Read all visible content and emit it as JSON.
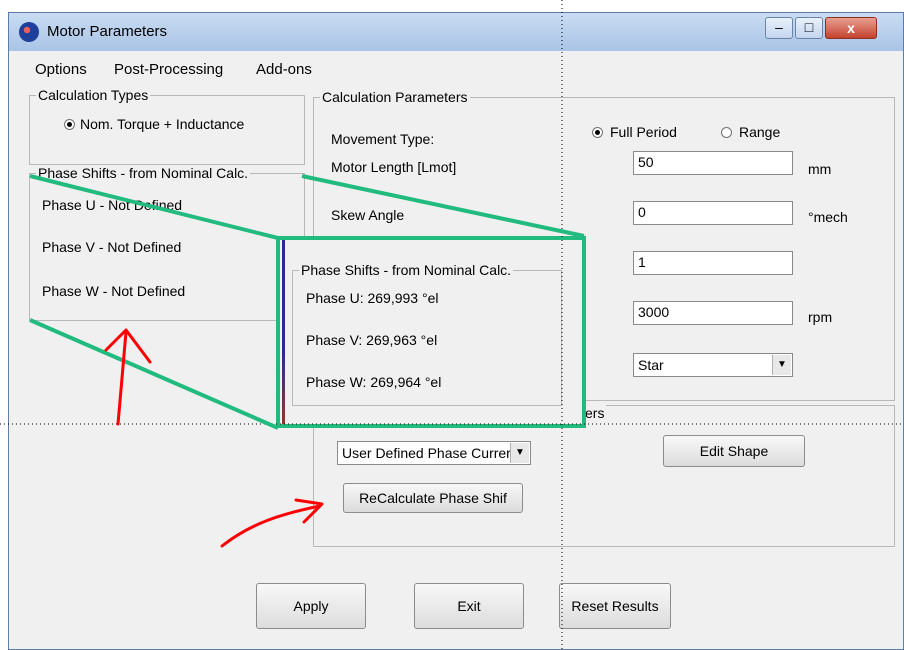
{
  "window": {
    "title": "Motor Parameters",
    "controls": [
      "–",
      "□",
      "x"
    ]
  },
  "menu": [
    "Options",
    "Post-Processing",
    "Add-ons"
  ],
  "calc_types": {
    "legend": "Calculation Types",
    "option_label": "Nom. Torque + Inductance"
  },
  "phase_shifts": {
    "legend": "Phase Shifts - from Nominal Calc.",
    "items": [
      "Phase U - Not Defined",
      "Phase V - Not Defined",
      "Phase W - Not Defined"
    ]
  },
  "calc_params": {
    "legend": "Calculation Parameters",
    "movement_label": "Movement Type:",
    "full_period": "Full Period",
    "range": "Range",
    "motor_length_label": "Motor Length [Lmot]",
    "motor_length_value": "50",
    "motor_length_unit": "mm",
    "skew_label": "Skew Angle",
    "skew_value": "0",
    "skew_unit": "°mech",
    "field3_value": "1",
    "speed_value": "3000",
    "speed_unit": "rpm",
    "connection_value": "Star"
  },
  "magnified": {
    "legend": "Phase Shifts - from Nominal Calc.",
    "items": [
      "Phase U: 269,993 °el",
      "Phase V: 269,963 °el",
      "Phase W: 269,964 °el"
    ]
  },
  "current_group": {
    "legend_fragment": "ers",
    "phase_current_select": "User Defined Phase Currer",
    "edit_shape_button": "Edit Shape",
    "recalculate_button": "ReCalculate  Phase Shif"
  },
  "buttons": {
    "apply": "Apply",
    "exit": "Exit",
    "reset": "Reset Results"
  },
  "annotation_colors": {
    "callout": "#22bb7f",
    "arrows": "#ff0000"
  }
}
